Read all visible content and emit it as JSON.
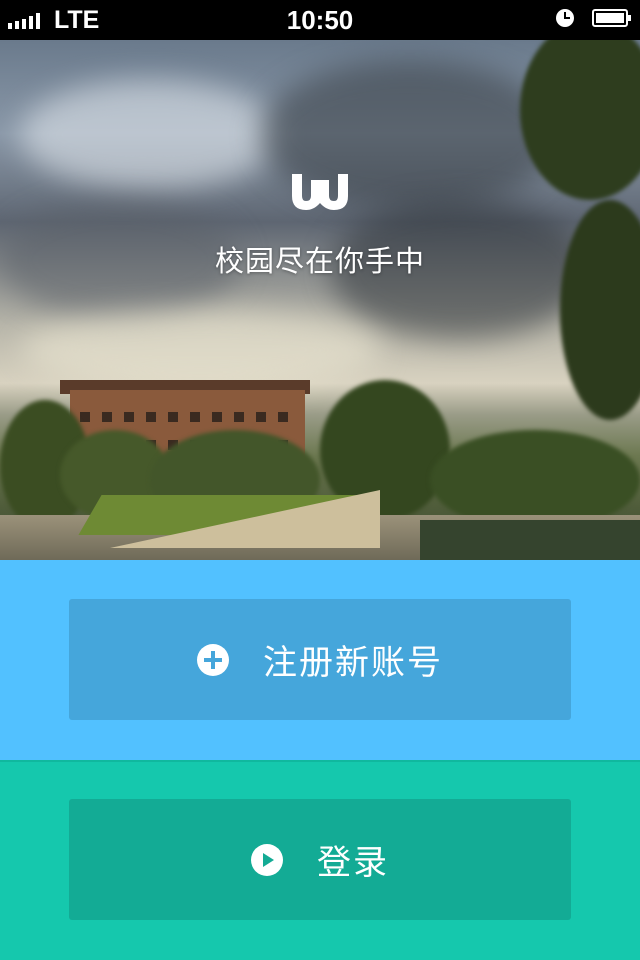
{
  "status_bar": {
    "carrier": "LTE",
    "time": "10:50",
    "icons": [
      "signal-icon",
      "alarm-icon",
      "battery-icon"
    ]
  },
  "hero": {
    "logo_icon": "w-logo-icon",
    "tagline": "校园尽在你手中"
  },
  "register": {
    "icon": "plus-circle-icon",
    "label": "注册新账号"
  },
  "login": {
    "icon": "play-circle-icon",
    "label": "登录"
  },
  "colors": {
    "register_background": "#52c1ff",
    "register_button": "#45a6db",
    "login_background": "#15c8ad",
    "login_button": "#13ab95"
  }
}
